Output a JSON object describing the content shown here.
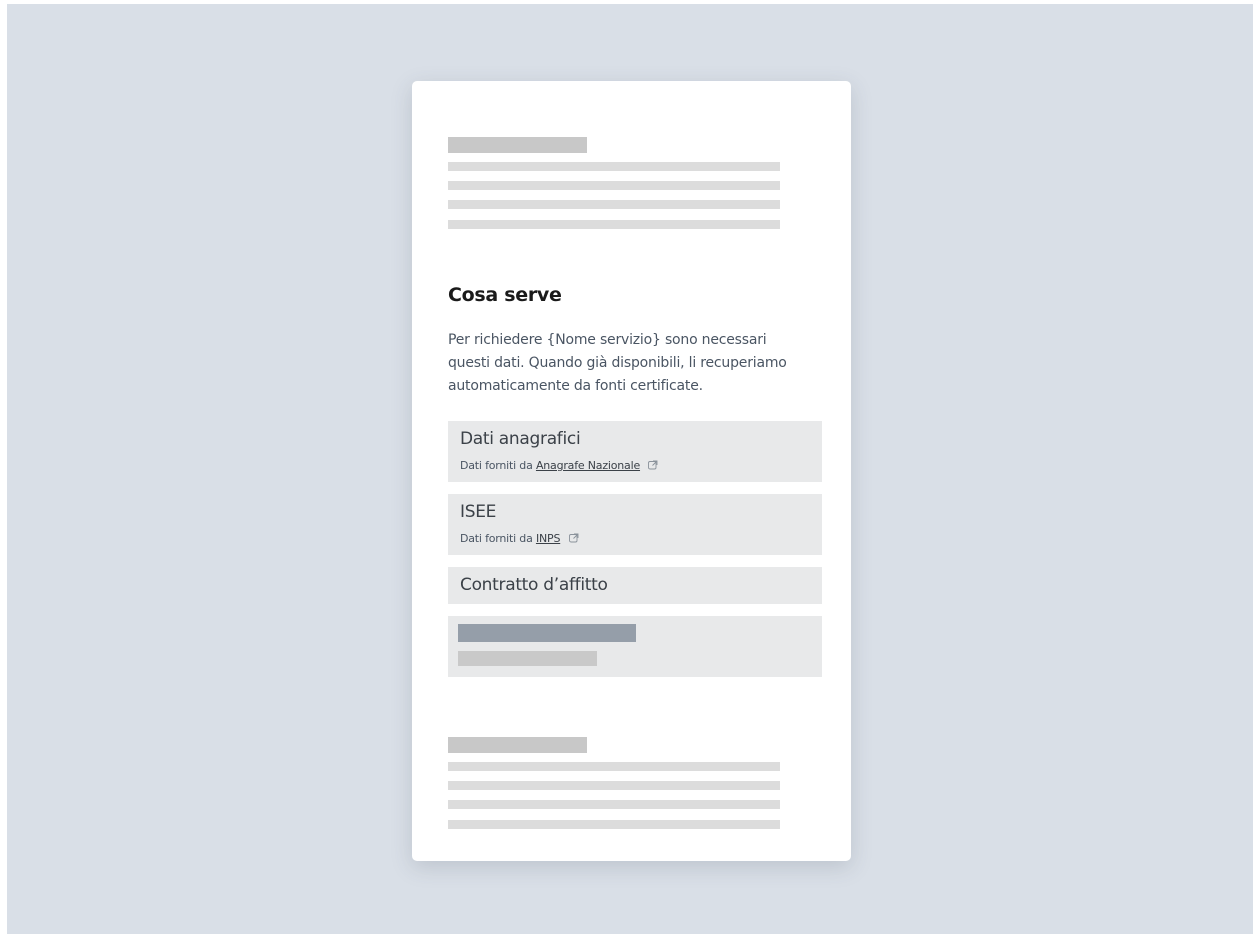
{
  "section": {
    "title": "Cosa serve",
    "intro": "Per richiedere {Nome servizio} sono necessari questi dati. Quando già disponibili, li recuperiamo automaticamente da fonti certificate."
  },
  "items": [
    {
      "title": "Dati anagrafici",
      "source_prefix": "Dati forniti da",
      "source_link": "Anagrafe Nazionale"
    },
    {
      "title": "ISEE",
      "source_prefix": "Dati forniti da",
      "source_link": "INPS"
    },
    {
      "title": "Contratto d’affitto"
    }
  ],
  "icons": {
    "external_link": "external-link-icon"
  },
  "colors": {
    "background": "#d9dfe7",
    "card": "#ffffff",
    "item_background": "#e8e9ea",
    "placeholder_dark": "#959ea9",
    "placeholder_light": "#c9c9c9"
  }
}
